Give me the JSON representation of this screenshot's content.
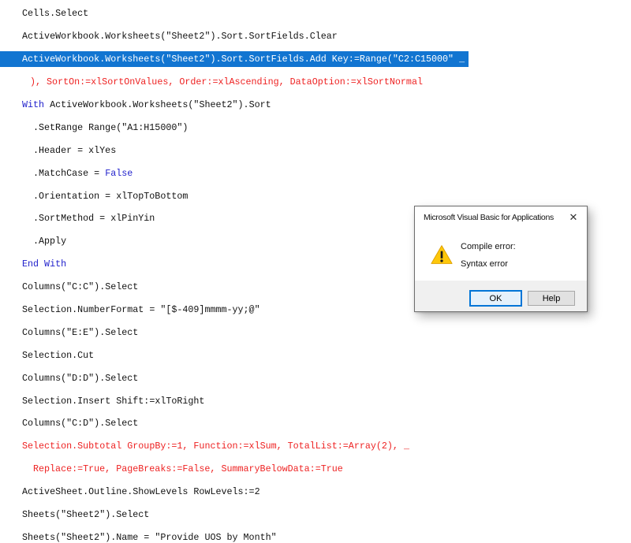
{
  "editor": {
    "lines": [
      {
        "indent": 0,
        "segments": [
          {
            "kind": "code",
            "text": "Cells.Select"
          }
        ]
      },
      {
        "indent": 0,
        "segments": [
          {
            "kind": "code",
            "text": "ActiveWorkbook.Worksheets(\"Sheet2\").Sort.SortFields.Clear"
          }
        ]
      },
      {
        "indent": 0,
        "selected": true,
        "segments": [
          {
            "kind": "sel",
            "text": "ActiveWorkbook.Worksheets(\"Sheet2\").Sort.SortFields.Add Key:=Range(\"C2:C15000\" _"
          }
        ]
      },
      {
        "indent": 1,
        "segments": [
          {
            "kind": "err",
            "text": "), SortOn:=xlSortOnValues, Order:=xlAscending, DataOption:=xlSortNormal"
          }
        ]
      },
      {
        "indent": 0,
        "segments": [
          {
            "kind": "kw",
            "text": "With "
          },
          {
            "kind": "code",
            "text": "ActiveWorkbook.Worksheets(\"Sheet2\").Sort"
          }
        ]
      },
      {
        "indent": 2,
        "segments": [
          {
            "kind": "code",
            "text": ".SetRange Range(\"A1:H15000\")"
          }
        ]
      },
      {
        "indent": 2,
        "segments": [
          {
            "kind": "code",
            "text": ".Header = xlYes"
          }
        ]
      },
      {
        "indent": 2,
        "segments": [
          {
            "kind": "code",
            "text": ".MatchCase = "
          },
          {
            "kind": "kw",
            "text": "False"
          }
        ]
      },
      {
        "indent": 2,
        "segments": [
          {
            "kind": "code",
            "text": ".Orientation = xlTopToBottom"
          }
        ]
      },
      {
        "indent": 2,
        "segments": [
          {
            "kind": "code",
            "text": ".SortMethod = xlPinYin"
          }
        ]
      },
      {
        "indent": 2,
        "segments": [
          {
            "kind": "code",
            "text": ".Apply"
          }
        ]
      },
      {
        "indent": 0,
        "segments": [
          {
            "kind": "kw",
            "text": "End With"
          }
        ]
      },
      {
        "indent": 0,
        "segments": [
          {
            "kind": "code",
            "text": "Columns(\"C:C\").Select"
          }
        ]
      },
      {
        "indent": 0,
        "segments": [
          {
            "kind": "code",
            "text": "Selection.NumberFormat = \"[$-409]mmmm-yy;@\""
          }
        ]
      },
      {
        "indent": 0,
        "segments": [
          {
            "kind": "code",
            "text": "Columns(\"E:E\").Select"
          }
        ]
      },
      {
        "indent": 0,
        "segments": [
          {
            "kind": "code",
            "text": "Selection.Cut"
          }
        ]
      },
      {
        "indent": 0,
        "segments": [
          {
            "kind": "code",
            "text": "Columns(\"D:D\").Select"
          }
        ]
      },
      {
        "indent": 0,
        "segments": [
          {
            "kind": "code",
            "text": "Selection.Insert Shift:=xlToRight"
          }
        ]
      },
      {
        "indent": 0,
        "segments": [
          {
            "kind": "code",
            "text": "Columns(\"C:D\").Select"
          }
        ]
      },
      {
        "indent": 0,
        "segments": [
          {
            "kind": "err",
            "text": "Selection.Subtotal GroupBy:=1, Function:=xlSum, TotalList:=Array(2), _"
          }
        ]
      },
      {
        "indent": 2,
        "segments": [
          {
            "kind": "err",
            "text": "Replace:=True, PageBreaks:=False, SummaryBelowData:=True"
          }
        ]
      },
      {
        "indent": 0,
        "segments": [
          {
            "kind": "code",
            "text": "ActiveSheet.Outline.ShowLevels RowLevels:=2"
          }
        ]
      },
      {
        "indent": 0,
        "segments": [
          {
            "kind": "code",
            "text": "Sheets(\"Sheet2\").Select"
          }
        ]
      },
      {
        "indent": 0,
        "segments": [
          {
            "kind": "code",
            "text": "Sheets(\"Sheet2\").Name = \"Provide UOS by Month\""
          }
        ]
      }
    ]
  },
  "dialog": {
    "title": "Microsoft Visual Basic for Applications",
    "message_line1": "Compile error:",
    "message_line2": "Syntax error",
    "ok_label": "OK",
    "help_label": "Help",
    "close_icon": "✕",
    "warning_icon_name": "warning-triangle-icon"
  },
  "colors": {
    "selection_bg": "#1275d1",
    "selection_text": "#ffffff",
    "keyword_blue": "#2222cc",
    "error_red": "#ee2222",
    "code_text": "#111111",
    "ok_focus_border": "#0075d7",
    "ok_bg": "#e5f1fb",
    "footer_bg": "#f0f0f0",
    "warning_yellow": "#fdc70a"
  }
}
